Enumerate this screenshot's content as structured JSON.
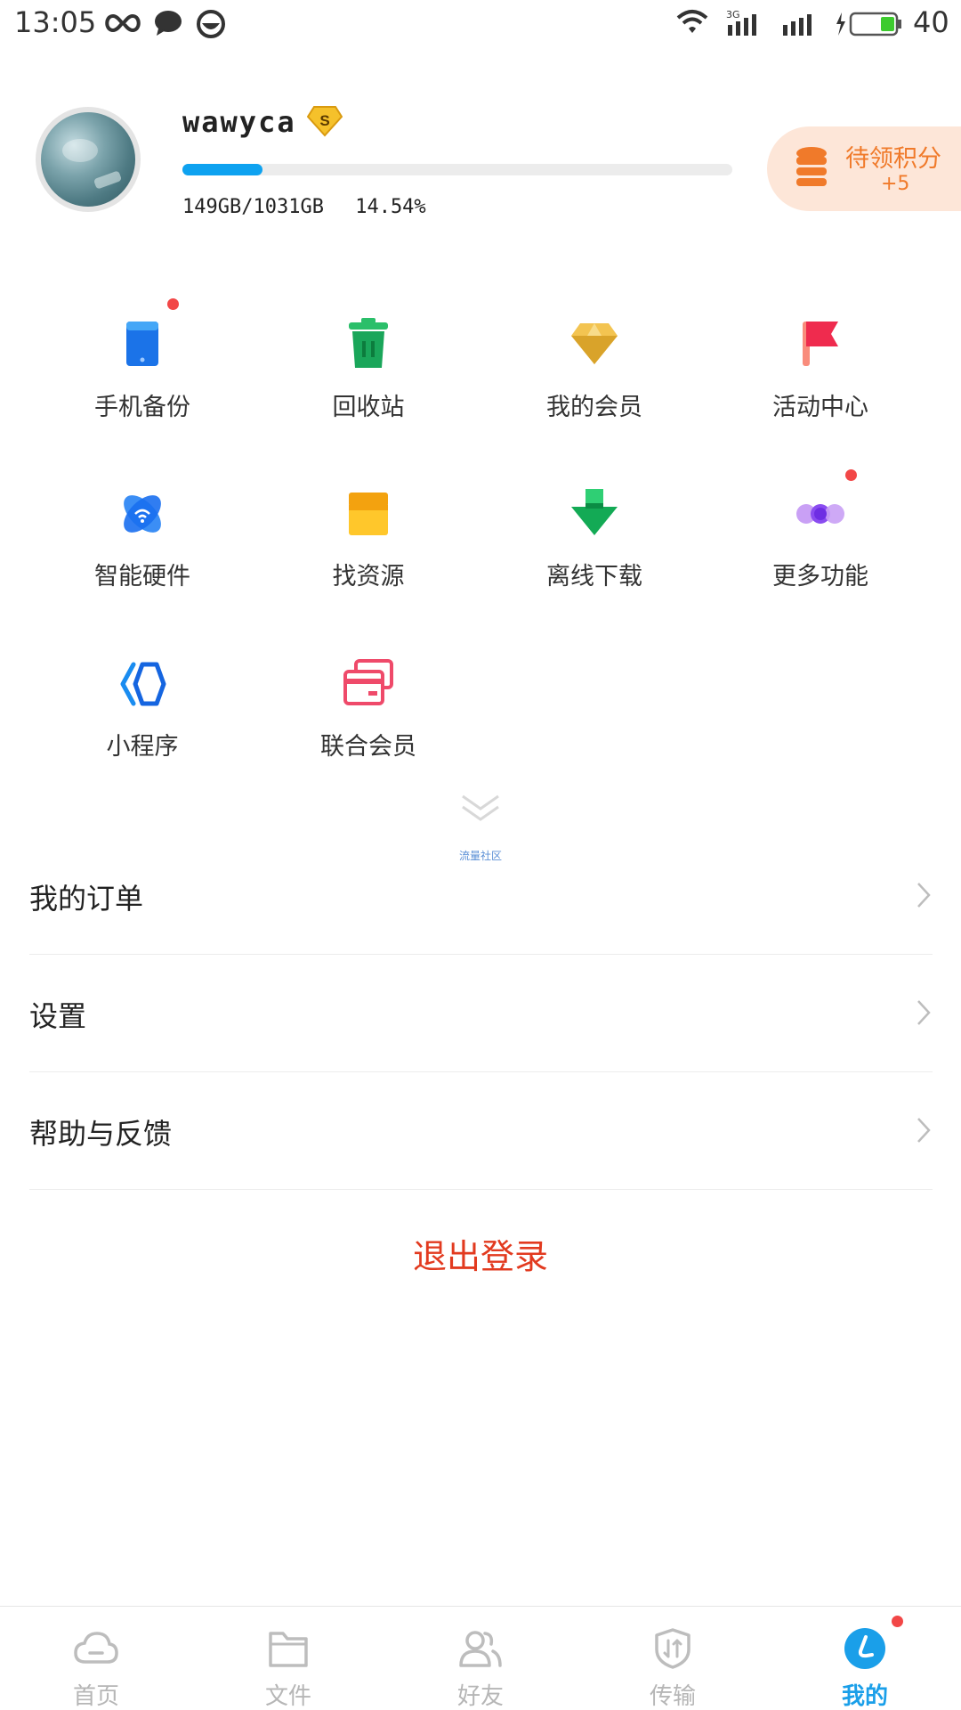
{
  "status_bar": {
    "time": "13:05",
    "network_label": "3G",
    "battery_level": "40"
  },
  "profile": {
    "username": "wawyca",
    "vip_badge_letter": "S",
    "storage_used": "149GB/1031GB",
    "storage_percent": "14.54%",
    "storage_fraction": 0.1454,
    "points_title": "待领积分",
    "points_delta": "+5"
  },
  "grid": [
    {
      "label": "手机备份",
      "icon": "phone-backup-icon",
      "badge": true
    },
    {
      "label": "回收站",
      "icon": "recycle-bin-icon",
      "badge": false
    },
    {
      "label": "我的会员",
      "icon": "diamond-icon",
      "badge": false
    },
    {
      "label": "活动中心",
      "icon": "flag-icon",
      "badge": false
    },
    {
      "label": "智能硬件",
      "icon": "smart-hardware-icon",
      "badge": false
    },
    {
      "label": "找资源",
      "icon": "store-icon",
      "badge": false
    },
    {
      "label": "离线下载",
      "icon": "download-arrow-icon",
      "badge": false
    },
    {
      "label": "更多功能",
      "icon": "more-dots-icon",
      "badge": true
    },
    {
      "label": "小程序",
      "icon": "mini-program-icon",
      "badge": false
    },
    {
      "label": "联合会员",
      "icon": "joint-membership-card-icon",
      "badge": false
    }
  ],
  "community_label": "流量社区",
  "menu": [
    {
      "label": "我的订单"
    },
    {
      "label": "设置"
    },
    {
      "label": "帮助与反馈"
    }
  ],
  "logout_label": "退出登录",
  "tabs": [
    {
      "label": "首页",
      "icon": "cloud-icon"
    },
    {
      "label": "文件",
      "icon": "folder-icon"
    },
    {
      "label": "好友",
      "icon": "friends-icon"
    },
    {
      "label": "传输",
      "icon": "transfer-shield-icon"
    },
    {
      "label": "我的",
      "icon": "me-icon"
    }
  ],
  "colors": {
    "accent": "#1a9fe9",
    "logout": "#e23a1f",
    "points": "#f07a2a"
  }
}
